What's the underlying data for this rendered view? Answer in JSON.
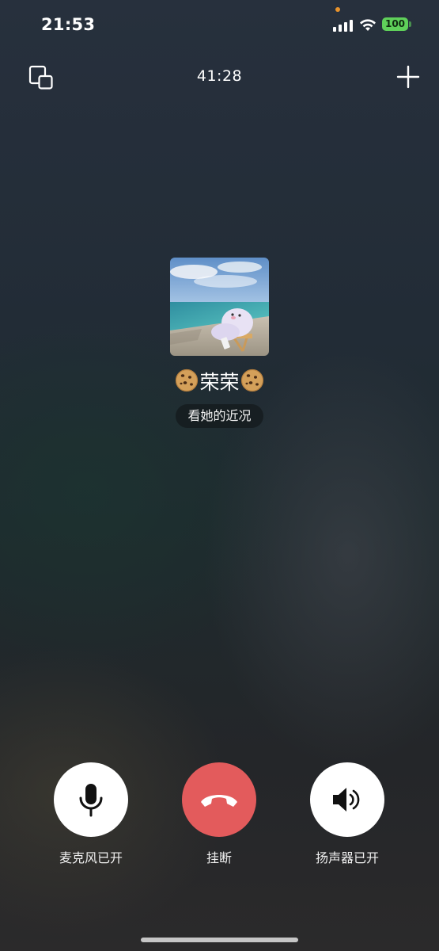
{
  "status_bar": {
    "time": "21:53",
    "battery": "100",
    "signal_icon": "cellular-signal-icon",
    "wifi_icon": "wifi-icon",
    "battery_color": "#5fd05a"
  },
  "top_bar": {
    "minimize_icon": "minimize-window-icon",
    "timer": "41:28",
    "add_icon": "plus-icon"
  },
  "caller": {
    "name_prefix_emoji": "cookie-emoji",
    "name": "荣荣",
    "name_suffix_emoji": "cookie-emoji",
    "status_chip": "看她的近况",
    "avatar": "beach-photo-with-plush-toy"
  },
  "controls": [
    {
      "icon": "microphone-icon",
      "label": "麦克风已开",
      "color": "#ffffff"
    },
    {
      "icon": "hang-up-phone-icon",
      "label": "挂断",
      "color": "#e35b5c"
    },
    {
      "icon": "speaker-icon",
      "label": "扬声器已开",
      "color": "#ffffff"
    }
  ]
}
